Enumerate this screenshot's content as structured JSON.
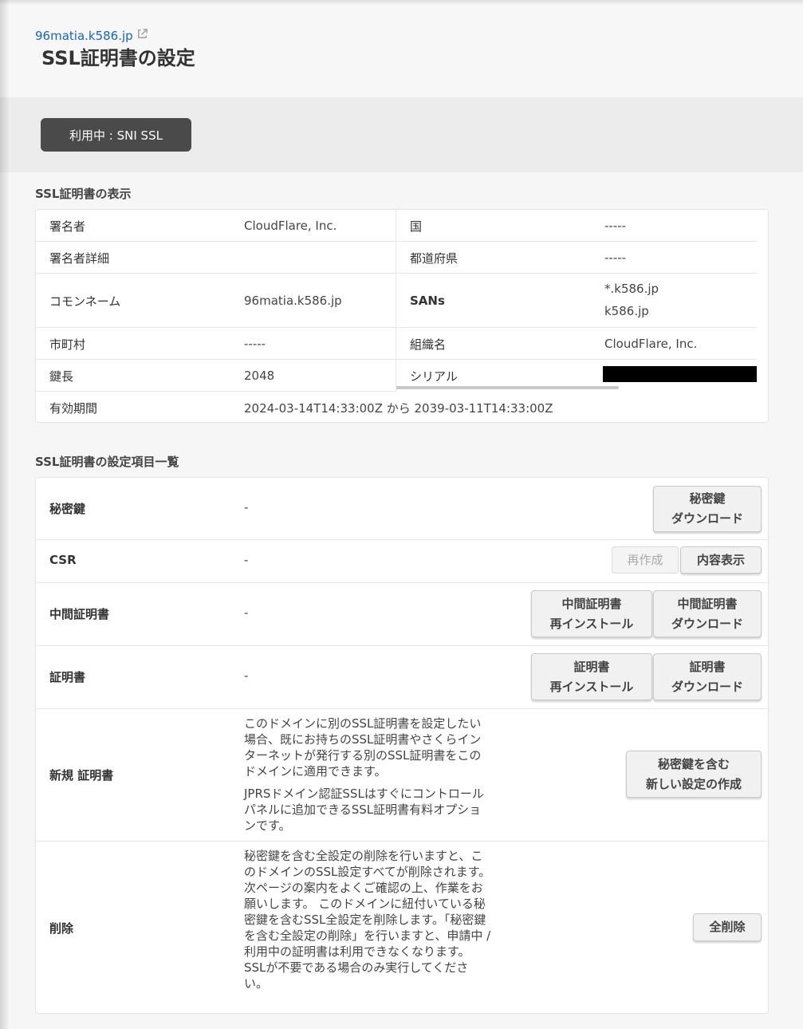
{
  "header": {
    "domain": "96matia.k586.jp",
    "title": "SSL証明書の設定"
  },
  "status": {
    "label": "利用中 : SNI SSL"
  },
  "cert_section": {
    "title": "SSL証明書の表示",
    "issuer_label": "署名者",
    "issuer_value": "CloudFlare, Inc.",
    "country_label": "国",
    "country_value": "-----",
    "issuer_detail_label": "署名者詳細",
    "issuer_detail_value": "",
    "prefecture_label": "都道府県",
    "prefecture_value": "-----",
    "common_name_label": "コモンネーム",
    "common_name_value": "96matia.k586.jp",
    "sans_label": "SANs",
    "sans_values": [
      "*.k586.jp",
      "k586.jp"
    ],
    "city_label": "市町村",
    "city_value": "-----",
    "org_label": "組織名",
    "org_value": "CloudFlare, Inc.",
    "key_length_label": "鍵長",
    "key_length_value": "2048",
    "serial_label": "シリアル",
    "validity_label": "有効期間",
    "validity_value": "2024-03-14T14:33:00Z から 2039-03-11T14:33:00Z"
  },
  "settings_section": {
    "title": "SSL証明書の設定項目一覧",
    "rows": [
      {
        "label": "秘密鍵",
        "value": "-",
        "buttons": [
          {
            "line1": "秘密鍵",
            "line2": "ダウンロード"
          }
        ]
      },
      {
        "label": "CSR",
        "value": "-",
        "buttons": [
          {
            "line1": "再作成",
            "disabled": true
          },
          {
            "line1": "内容表示"
          }
        ]
      },
      {
        "label": "中間証明書",
        "value": "-",
        "buttons": [
          {
            "line1": "中間証明書",
            "line2": "再インストール"
          },
          {
            "line1": "中間証明書",
            "line2": "ダウンロード"
          }
        ]
      },
      {
        "label": "証明書",
        "value": "-",
        "buttons": [
          {
            "line1": "証明書",
            "line2": "再インストール"
          },
          {
            "line1": "証明書",
            "line2": "ダウンロード"
          }
        ]
      },
      {
        "label": "新規 証明書",
        "desc": [
          "このドメインに別のSSL証明書を設定したい場合、既にお持ちのSSL証明書やさくらインターネットが発行する別のSSL証明書をこのドメインに適用できます。",
          "JPRSドメイン認証SSLはすぐにコントロールパネルに追加できるSSL証明書有料オプションです。"
        ],
        "buttons": [
          {
            "line1": "秘密鍵を含む",
            "line2": "新しい設定の作成"
          }
        ]
      },
      {
        "label": "削除",
        "desc": [
          "秘密鍵を含む全設定の削除を行いますと、このドメインのSSL設定すべてが削除されます。次ページの案内をよくご確認の上、作業をお願いします。 このドメインに紐付いている秘密鍵を含むSSL全設定を削除します。「秘密鍵を含む全設定の削除」を行いますと、申請中 / 利用中の証明書は利用できなくなります。SSLが不要である場合のみ実行してください。"
        ],
        "buttons": [
          {
            "line1": "全削除"
          }
        ]
      }
    ]
  }
}
